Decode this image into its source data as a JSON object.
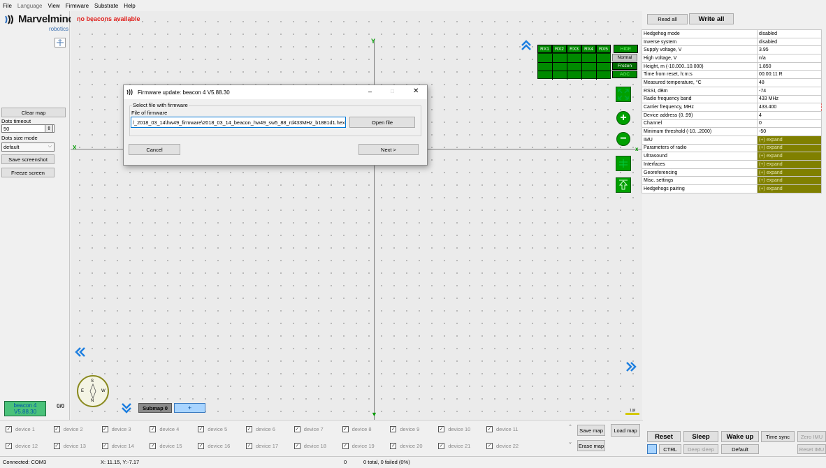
{
  "menu": [
    "File",
    "Language",
    "View",
    "Firmware",
    "Substrate",
    "Help"
  ],
  "logo": {
    "name": "Marvelmind",
    "sub": "robotics"
  },
  "status_message": "no beacons available",
  "left": {
    "clear_map": "Clear map",
    "dots_timeout_label": "Dots timeout",
    "dots_timeout_value": "50",
    "dots_size_label": "Dots size mode",
    "dots_size_value": "default",
    "save_screenshot": "Save screenshot",
    "freeze_screen": "Freeze screen",
    "beacon_label": "beacon 4",
    "beacon_version": "V5.88.30",
    "counter": "0/0"
  },
  "map": {
    "rx_buttons": [
      "RX1",
      "RX2",
      "RX3",
      "RX4",
      "RX5"
    ],
    "hide": "HIDE",
    "normal": "Normal",
    "frozen": "Frozen",
    "agc": "AGC",
    "x_label": "X",
    "y_label": "Y",
    "submap": "Submap 0",
    "submap_add": "+",
    "scale": "1 M",
    "compass": {
      "n": "N",
      "s": "S",
      "e": "E",
      "w": "W"
    }
  },
  "dialog": {
    "title": "Firmware update: beacon 4  V5.88.30",
    "group_label": "Select file with firmware",
    "file_label": "File of firmware",
    "file_value": "/_2018_03_14\\hw49_firmware\\2018_03_14_beacon_hw49_sw5_88_rd433MHz_b1881d1.hex",
    "open_file": "Open file",
    "cancel": "Cancel",
    "next": "Next >"
  },
  "right": {
    "read_all": "Read all",
    "write_all": "Write all",
    "props": [
      {
        "k": "Hedgehog mode",
        "v": "disabled"
      },
      {
        "k": "Inverse system",
        "v": "disabled"
      },
      {
        "k": "Supply voltage, V",
        "v": "3.95"
      },
      {
        "k": "High voltage, V",
        "v": "n/a"
      },
      {
        "k": "Height, m (-10.000..10.000)",
        "v": "1.850"
      },
      {
        "k": "Time from reset, h:m:s",
        "v": "00:00:11   R"
      },
      {
        "k": "Measured temperature, °C",
        "v": "48"
      },
      {
        "k": "RSSI, dBm",
        "v": "-74"
      },
      {
        "k": "Radio frequency band",
        "v": "433 MHz"
      },
      {
        "k": "Carrier frequency, MHz",
        "v": "433.400"
      },
      {
        "k": "Device address (0..99)",
        "v": "4"
      },
      {
        "k": "Channel",
        "v": "0"
      },
      {
        "k": "Minimum threshold (-10...2000)",
        "v": "-50"
      },
      {
        "k": "IMU",
        "v": "(+) expand"
      },
      {
        "k": "Parameters of radio",
        "v": "(+) expand"
      },
      {
        "k": "Ultrasound",
        "v": "(+) expand"
      },
      {
        "k": "Interfaces",
        "v": "(+) expand"
      },
      {
        "k": "Georeferencing",
        "v": "(+) expand"
      },
      {
        "k": "Misc. settings",
        "v": "(+) expand"
      },
      {
        "k": "Hedgehogs pairing",
        "v": "(+) expand"
      }
    ],
    "reset": "Reset",
    "sleep": "Sleep",
    "wake_up": "Wake up",
    "time_sync": "Time sync",
    "zero_imu": "Zero IMU",
    "ctrl": "CTRL",
    "deep_sleep": "Deep sleep",
    "default": "Default",
    "reset_imu": "Reset IMU"
  },
  "devices_row1": [
    "device 1",
    "device 2",
    "device 3",
    "device 4",
    "device 5",
    "device 6",
    "device 7",
    "device 8",
    "device 9",
    "device 10",
    "device 11"
  ],
  "devices_row2": [
    "device 12",
    "device 13",
    "device 14",
    "device 15",
    "device 16",
    "device 17",
    "device 18",
    "device 19",
    "device 20",
    "device 21",
    "device 22"
  ],
  "map_buttons": {
    "save_map": "Save map",
    "load_map": "Load map",
    "erase_map": "Erase map"
  },
  "statusbar": {
    "connected": "Connected: COM3",
    "coords": "X: 11.15, Y:-7.17",
    "zero": "0",
    "total": "0 total, 0 failed (0%)"
  }
}
